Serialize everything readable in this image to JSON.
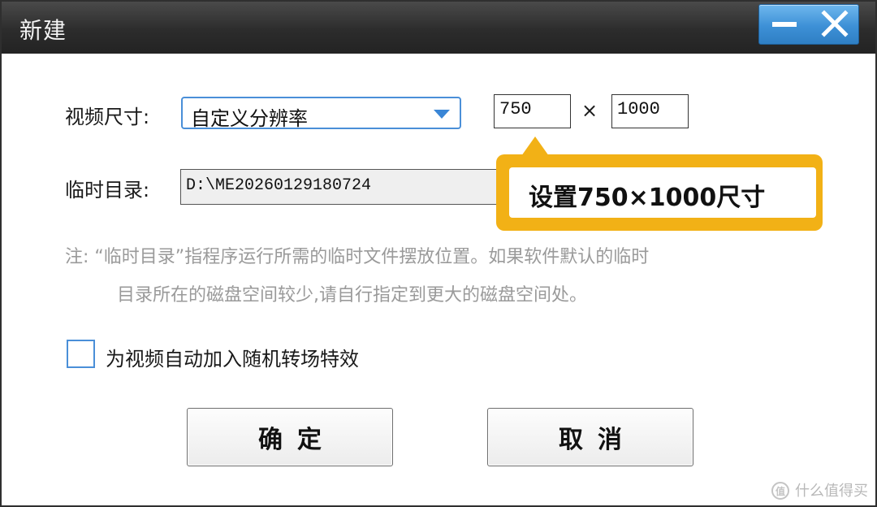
{
  "window": {
    "title": "新建",
    "minimize_icon": "minimize-icon",
    "close_icon": "close-icon"
  },
  "form": {
    "video_size_label": "视频尺寸:",
    "video_size_selected": "自定义分辨率",
    "width_value": "750",
    "times_sign": "×",
    "height_value": "1000",
    "temp_dir_label": "临时目录:",
    "temp_dir_value": "D:\\ME20260129180724",
    "note_line1": "注:  “临时目录”指程序运行所需的临时文件摆放位置。如果软件默认的临时",
    "note_line2": "目录所在的磁盘空间较少,请自行指定到更大的磁盘空间处。",
    "random_transition_label": "为视频自动加入随机转场特效",
    "random_transition_checked": false
  },
  "callout": {
    "text": "设置750×1000尺寸",
    "color": "#f2b116"
  },
  "buttons": {
    "ok": "确定",
    "cancel": "取消"
  },
  "watermark": {
    "text": "什么值得买"
  },
  "colors": {
    "accent": "#4a8fd8",
    "titlebar": "#2c2c2c",
    "note": "#9a9a9a"
  }
}
